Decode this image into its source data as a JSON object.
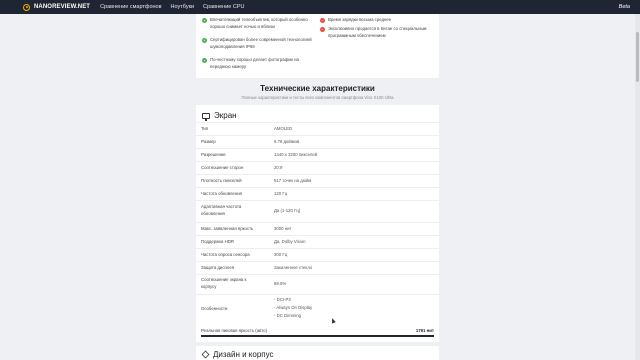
{
  "header": {
    "logo": "NANOREVIEW.NET",
    "nav": [
      "Сравнение смартфонов",
      "Ноутбуки",
      "Сравнение CPU"
    ],
    "beta": "Beta"
  },
  "pros": [
    "Впечатляющий телеобъектив, который особенно хорошо снимает ночью и вблизи",
    "Сертифицирован более современной технологией шумоподавления IP69",
    "По-честному хорошо делает фотографии на переднюю камеру"
  ],
  "cons": [
    "Время зарядки весьма среднее",
    "Эксклюзивно продается в Китае со специальным программным обеспечением"
  ],
  "section": {
    "title": "Технические характеристики",
    "subtitle": "Полные характеристики и тесты всех компонентов смартфона Vivo X100 Ultra"
  },
  "screen": {
    "title": "Экран",
    "rows": [
      {
        "label": "Тип",
        "value": "AMOLED"
      },
      {
        "label": "Размер",
        "value": "6.78 дюймов"
      },
      {
        "label": "Разрешение",
        "value": "1440 x 3200 пикселей"
      },
      {
        "label": "Соотношение сторон",
        "value": "20:9"
      },
      {
        "label": "Плотность пикселей",
        "value": "517 точек на дюйм"
      },
      {
        "label": "Частота обновления",
        "value": "120 Гц"
      },
      {
        "label": "Адаптивная частота обновления",
        "value": "Да (1-120 Гц)"
      },
      {
        "label": "Макс. заявленная яркость",
        "value": "3000 нит"
      },
      {
        "label": "Поддержка HDR",
        "value": "Да, Dolby Vision"
      },
      {
        "label": "Частота опроса сенсора",
        "value": "300 Гц"
      },
      {
        "label": "Защита дисплея",
        "value": "Закаленное стекло"
      },
      {
        "label": "Соотношение экрана к корпусу",
        "value": "89.5%"
      }
    ],
    "features_label": "Особенности",
    "features": [
      "- DCI-P3",
      "- Always On Display",
      "- DC Dimming"
    ],
    "brightness_label": "Реальная пиковая яркость (авто)",
    "brightness_value": "1791 нит",
    "brightness_fraction": 1.0
  },
  "design": {
    "title": "Дизайн и корпус"
  }
}
